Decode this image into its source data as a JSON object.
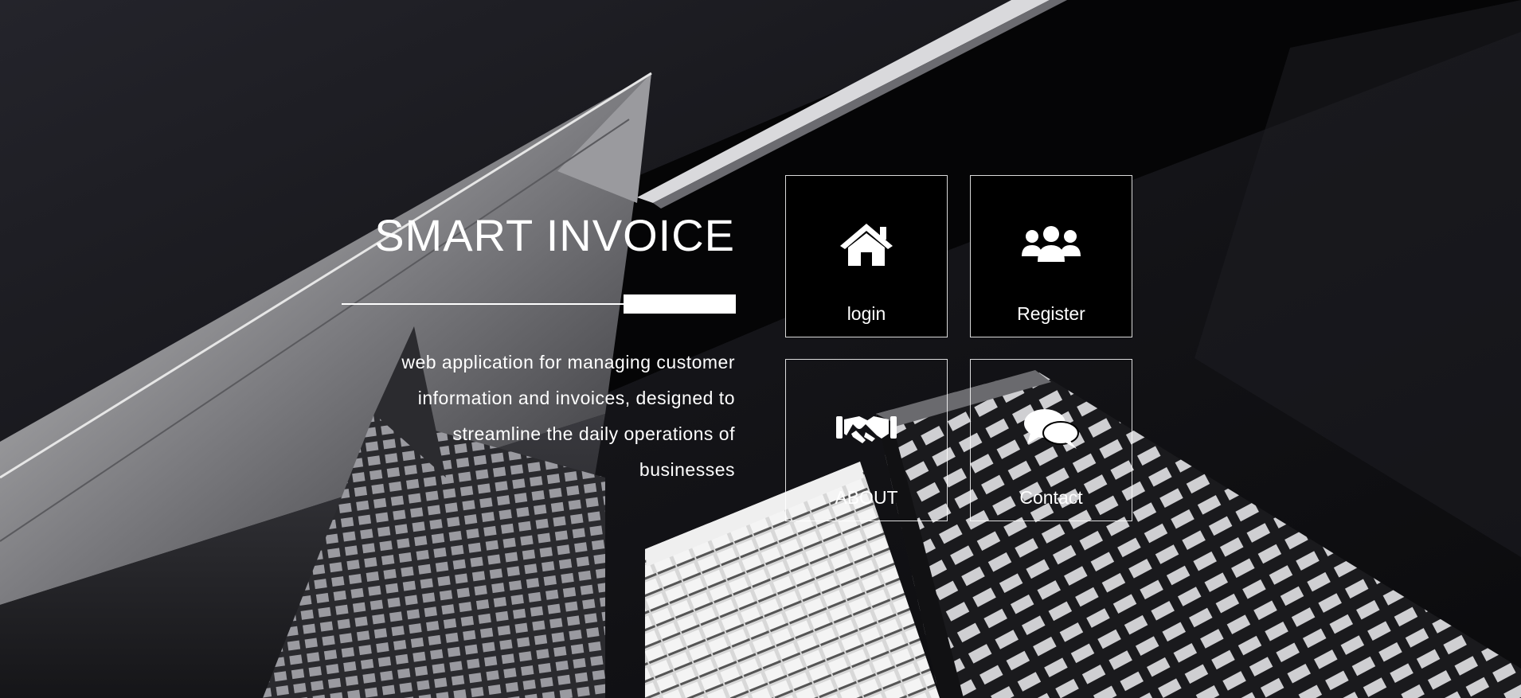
{
  "hero": {
    "title": "SMART INVOICE",
    "tagline_lines": [
      "web application for managing customer",
      "information and invoices, designed to",
      "streamline the daily operations of",
      "businesses"
    ]
  },
  "tiles": [
    {
      "label": "login",
      "icon": "home-icon"
    },
    {
      "label": "Register",
      "icon": "users-icon"
    },
    {
      "label": "ABOUT",
      "icon": "handshake-icon"
    },
    {
      "label": "Contact",
      "icon": "comments-icon"
    }
  ],
  "colors": {
    "text": "#ffffff",
    "tile_fill": "#000000",
    "tile_border": "#ffffff"
  }
}
